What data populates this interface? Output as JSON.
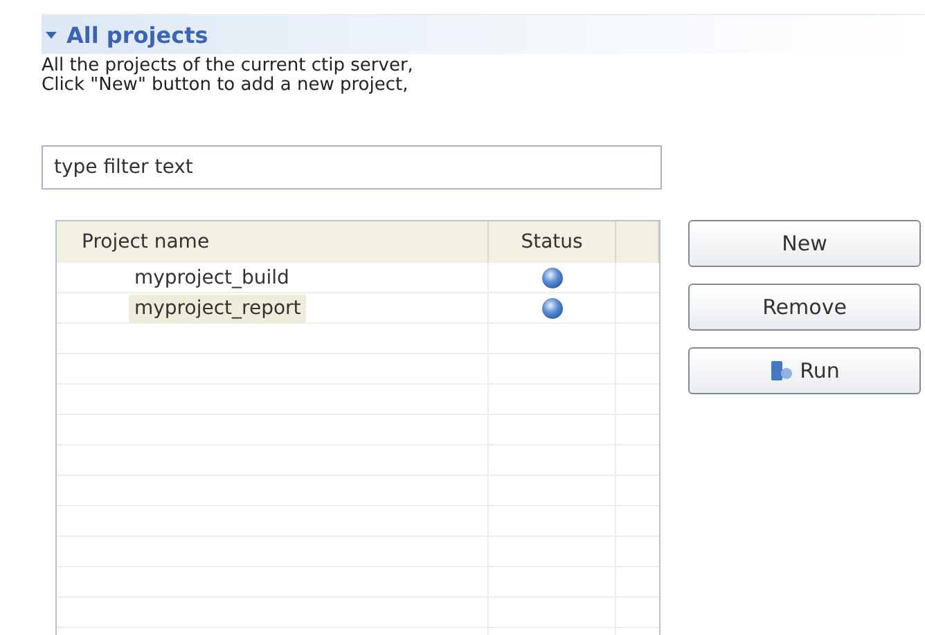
{
  "section": {
    "title": "All projects",
    "expanded": true,
    "description_lines": [
      "All the projects of the current ctip server,",
      "Click \"New\" button to add a new project,"
    ]
  },
  "filter": {
    "placeholder": "type filter text"
  },
  "table": {
    "columns": [
      "Project name",
      "Status"
    ],
    "rows": [
      {
        "name": "myproject_build",
        "selected": false,
        "active": true
      },
      {
        "name": "myproject_report",
        "selected": true,
        "active": true
      }
    ]
  },
  "buttons": [
    {
      "label": "New",
      "kind": "plain"
    },
    {
      "label": "Remove",
      "kind": "plain"
    },
    {
      "label": "Run",
      "kind": "run"
    }
  ]
}
